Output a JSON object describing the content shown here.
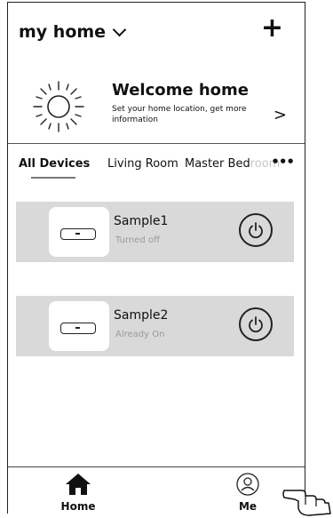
{
  "header": {
    "home_name": "my home",
    "add_icon": "plus-icon"
  },
  "welcome": {
    "title": "Welcome home",
    "subtitle": "Set your home location, get more information",
    "arrow": ">"
  },
  "tabs": [
    {
      "label": "All Devices",
      "active": true
    },
    {
      "label": "Living Room",
      "active": false
    },
    {
      "label": "Master Bed",
      "fade": "room",
      "active": false
    }
  ],
  "tabs_more": "•••",
  "devices": [
    {
      "name": "Sample1",
      "status": "Turned off",
      "icon": "air-conditioner-icon"
    },
    {
      "name": "Sample2",
      "status": "Already On",
      "icon": "air-conditioner-icon"
    }
  ],
  "bottom_nav": {
    "home_label": "Home",
    "me_label": "Me"
  },
  "colors": {
    "card_background": "#d9d9d9",
    "status_text": "#9a9a9a"
  }
}
